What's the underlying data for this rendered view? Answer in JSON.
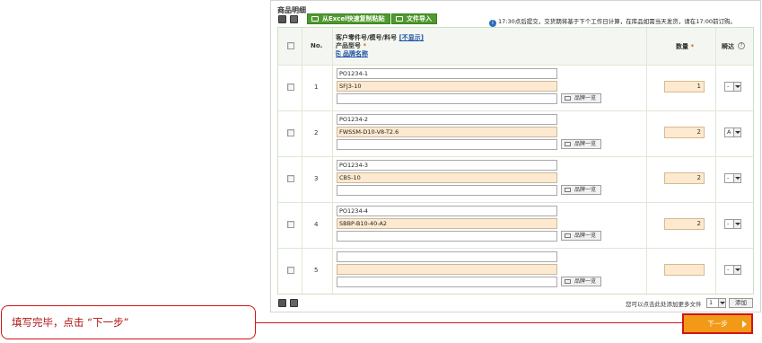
{
  "section_title": "商品明细",
  "toolbar": {
    "excel_paste_label": "从Excel快速复制粘贴",
    "file_import_label": "文件导入",
    "notice": "17:30点后提交，交货期将基于下个工作日计算，在库品如需当天发货，请在17:00前订购。"
  },
  "table": {
    "header_no": "No.",
    "header_part_line1": "客户零件号/模号/料号",
    "header_hide_link": "[不显示]",
    "header_part_line2": "产品型号",
    "header_brand_link": "品牌名称",
    "header_qty": "数量",
    "header_express": "瞬达",
    "required_mark": "*",
    "help_mark": "?",
    "brand_button_label": "品牌一览",
    "rows": [
      {
        "no": "1",
        "customer_part": "PO1234-1",
        "model": "SFJ3-10",
        "brand": "",
        "qty": "1",
        "express": "-"
      },
      {
        "no": "2",
        "customer_part": "PO1234-2",
        "model": "FWSSM-D10-V8-T2.6",
        "brand": "",
        "qty": "2",
        "express": "A"
      },
      {
        "no": "3",
        "customer_part": "PO1234-3",
        "model": "CB5-10",
        "brand": "",
        "qty": "2",
        "express": "-"
      },
      {
        "no": "4",
        "customer_part": "PO1234-4",
        "model": "SBBP-B10-40-A2",
        "brand": "",
        "qty": "2",
        "express": "-"
      },
      {
        "no": "5",
        "customer_part": "",
        "model": "",
        "brand": "",
        "qty": "",
        "express": "-"
      }
    ]
  },
  "footer": {
    "add_rows_text": "您可以点击此处添加更多文件",
    "add_count": "1",
    "add_button_label": "添加"
  },
  "next_button_label": "下一步",
  "callout_text": "填写完毕，点击 “下一步”",
  "colors": {
    "accent_orange": "#f29a18",
    "highlight_red": "#d21414",
    "button_green": "#4e9a2e"
  }
}
